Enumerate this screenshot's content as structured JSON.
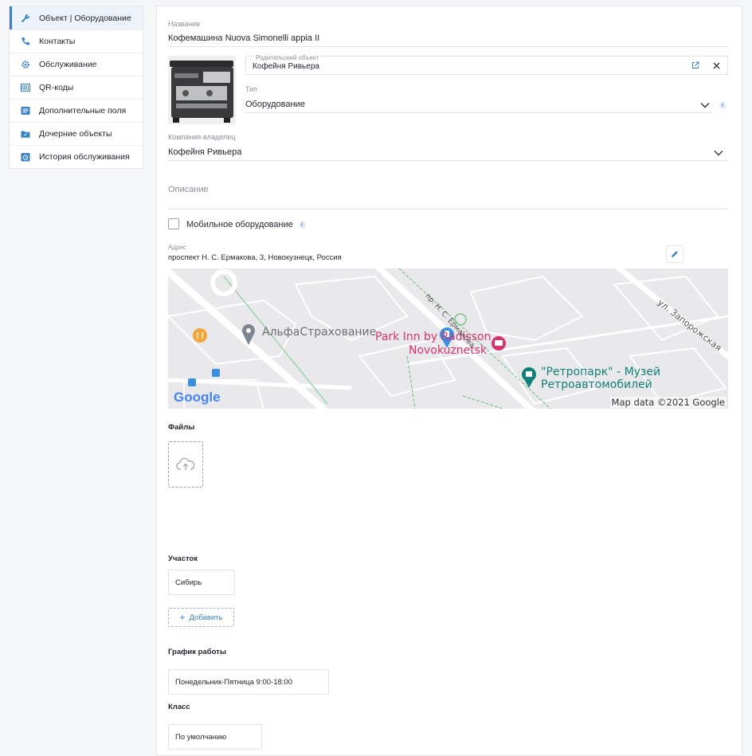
{
  "sidebar": {
    "items": [
      {
        "label": "Объект | Оборудование",
        "icon": "wrench-icon",
        "active": true
      },
      {
        "label": "Контакты",
        "icon": "phone-icon"
      },
      {
        "label": "Обслуживание",
        "icon": "gear-icon"
      },
      {
        "label": "QR-коды",
        "icon": "qr-icon"
      },
      {
        "label": "Дополнительные поля",
        "icon": "list-icon"
      },
      {
        "label": "Дочерние объекты",
        "icon": "folder-icon"
      },
      {
        "label": "История обслуживания",
        "icon": "history-icon"
      }
    ]
  },
  "form": {
    "name_label": "Название",
    "name_value": "Кофемашина Nuova Simonelli appia II",
    "parent_label": "Родительский объект",
    "parent_value": "Кофейня Ривьера",
    "type_label": "Тип",
    "type_value": "Оборудование",
    "company_label": "Компания-владелец",
    "company_value": "Кофейня Ривьера",
    "description_placeholder": "Описание",
    "mobile_label": "Мобильное оборудование",
    "mobile_checked": false,
    "address_label": "Адрес",
    "address_value": "проспект Н. С. Ермакова, 3, Новокузнецк, Россия"
  },
  "map": {
    "labels": {
      "alfa": "АльфаСтрахование",
      "parkinn": "Park Inn by Radisson",
      "parkinn2": "Novokuznetsk",
      "retro": "\"Ретропарк\" - Музей",
      "retro2": "Ретроавтомобилей",
      "street1": "пр. Н. С. Ермакова",
      "street2": "ул. Запорожская"
    },
    "attribution": "Map data ©2021 Google",
    "logo": "Google"
  },
  "files": {
    "title": "Файлы"
  },
  "area": {
    "title": "Участок",
    "value": "Сибирь",
    "add_label": "Добавить"
  },
  "schedule": {
    "title": "График работы",
    "value": "Понедельник-Пятница 9:00-18:00"
  },
  "class": {
    "title": "Класс",
    "value": "По умолчанию"
  },
  "colors": {
    "accent": "#3b82c4",
    "map_pink": "#d6336c",
    "map_teal": "#12807a"
  }
}
